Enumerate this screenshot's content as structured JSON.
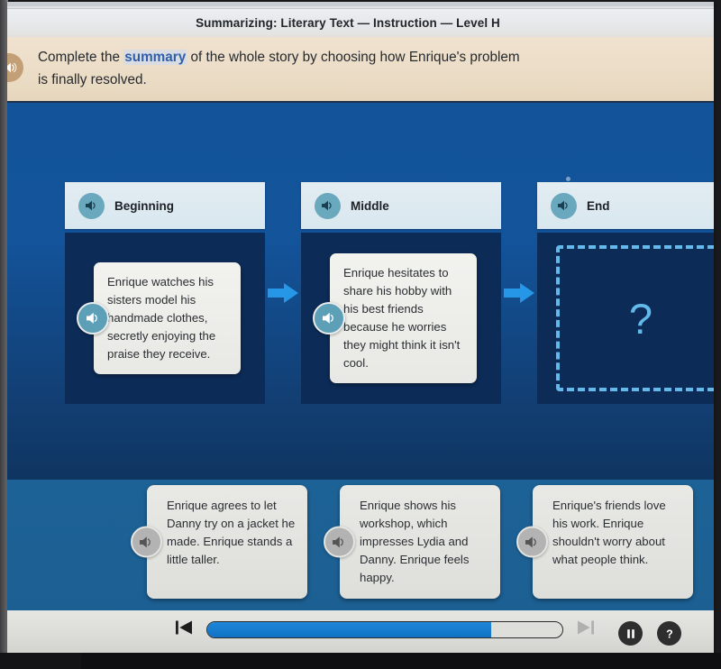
{
  "window": {
    "title": "Summarizing: Literary Text — Instruction — Level H"
  },
  "instruction": {
    "speaker_icon": "speaker-icon",
    "text_before": "Complete the ",
    "keyword": "summary",
    "text_after": " of the whole story by choosing how Enrique's problem is finally resolved."
  },
  "stage": {
    "columns": [
      {
        "id": "beginning",
        "label": "Beginning",
        "speaker_icon": "speaker-icon",
        "note": "Enrique watches his sisters model his handmade clothes, secretly enjoying the praise they receive.",
        "filled": true
      },
      {
        "id": "middle",
        "label": "Middle",
        "speaker_icon": "speaker-icon",
        "note": "Enrique hesitates to share his hobby with his best friends because he worries they might think it isn't cool.",
        "filled": true
      },
      {
        "id": "end",
        "label": "End",
        "speaker_icon": "speaker-icon",
        "note": "",
        "filled": false,
        "placeholder": "?"
      }
    ],
    "connector_icon": "arrow-right-icon"
  },
  "options": [
    {
      "id": "option-1",
      "speaker_icon": "speaker-icon",
      "text": "Enrique agrees to let Danny try on a jacket he made. Enrique stands a little taller."
    },
    {
      "id": "option-2",
      "speaker_icon": "speaker-icon",
      "text": "Enrique shows his workshop, which impresses Lydia and Danny. Enrique feels happy."
    },
    {
      "id": "option-3",
      "speaker_icon": "speaker-icon",
      "text": "Enrique's friends love his work. Enrique shouldn't worry about what people think."
    }
  ],
  "toolbar": {
    "skip_back_icon": "skip-back-icon",
    "skip_forward_icon": "skip-forward-icon",
    "pause_icon": "pause-icon",
    "help_icon": "help-icon",
    "progress_percent": 80
  },
  "colors": {
    "stage_blue": "#12539a",
    "panel_navy": "#0c2b57",
    "accent_cyan": "#2696e6",
    "dropzone_blue": "#63b9ea",
    "banner_tan": "#ebdcc6",
    "keyword_blue": "#2f5fa8"
  }
}
